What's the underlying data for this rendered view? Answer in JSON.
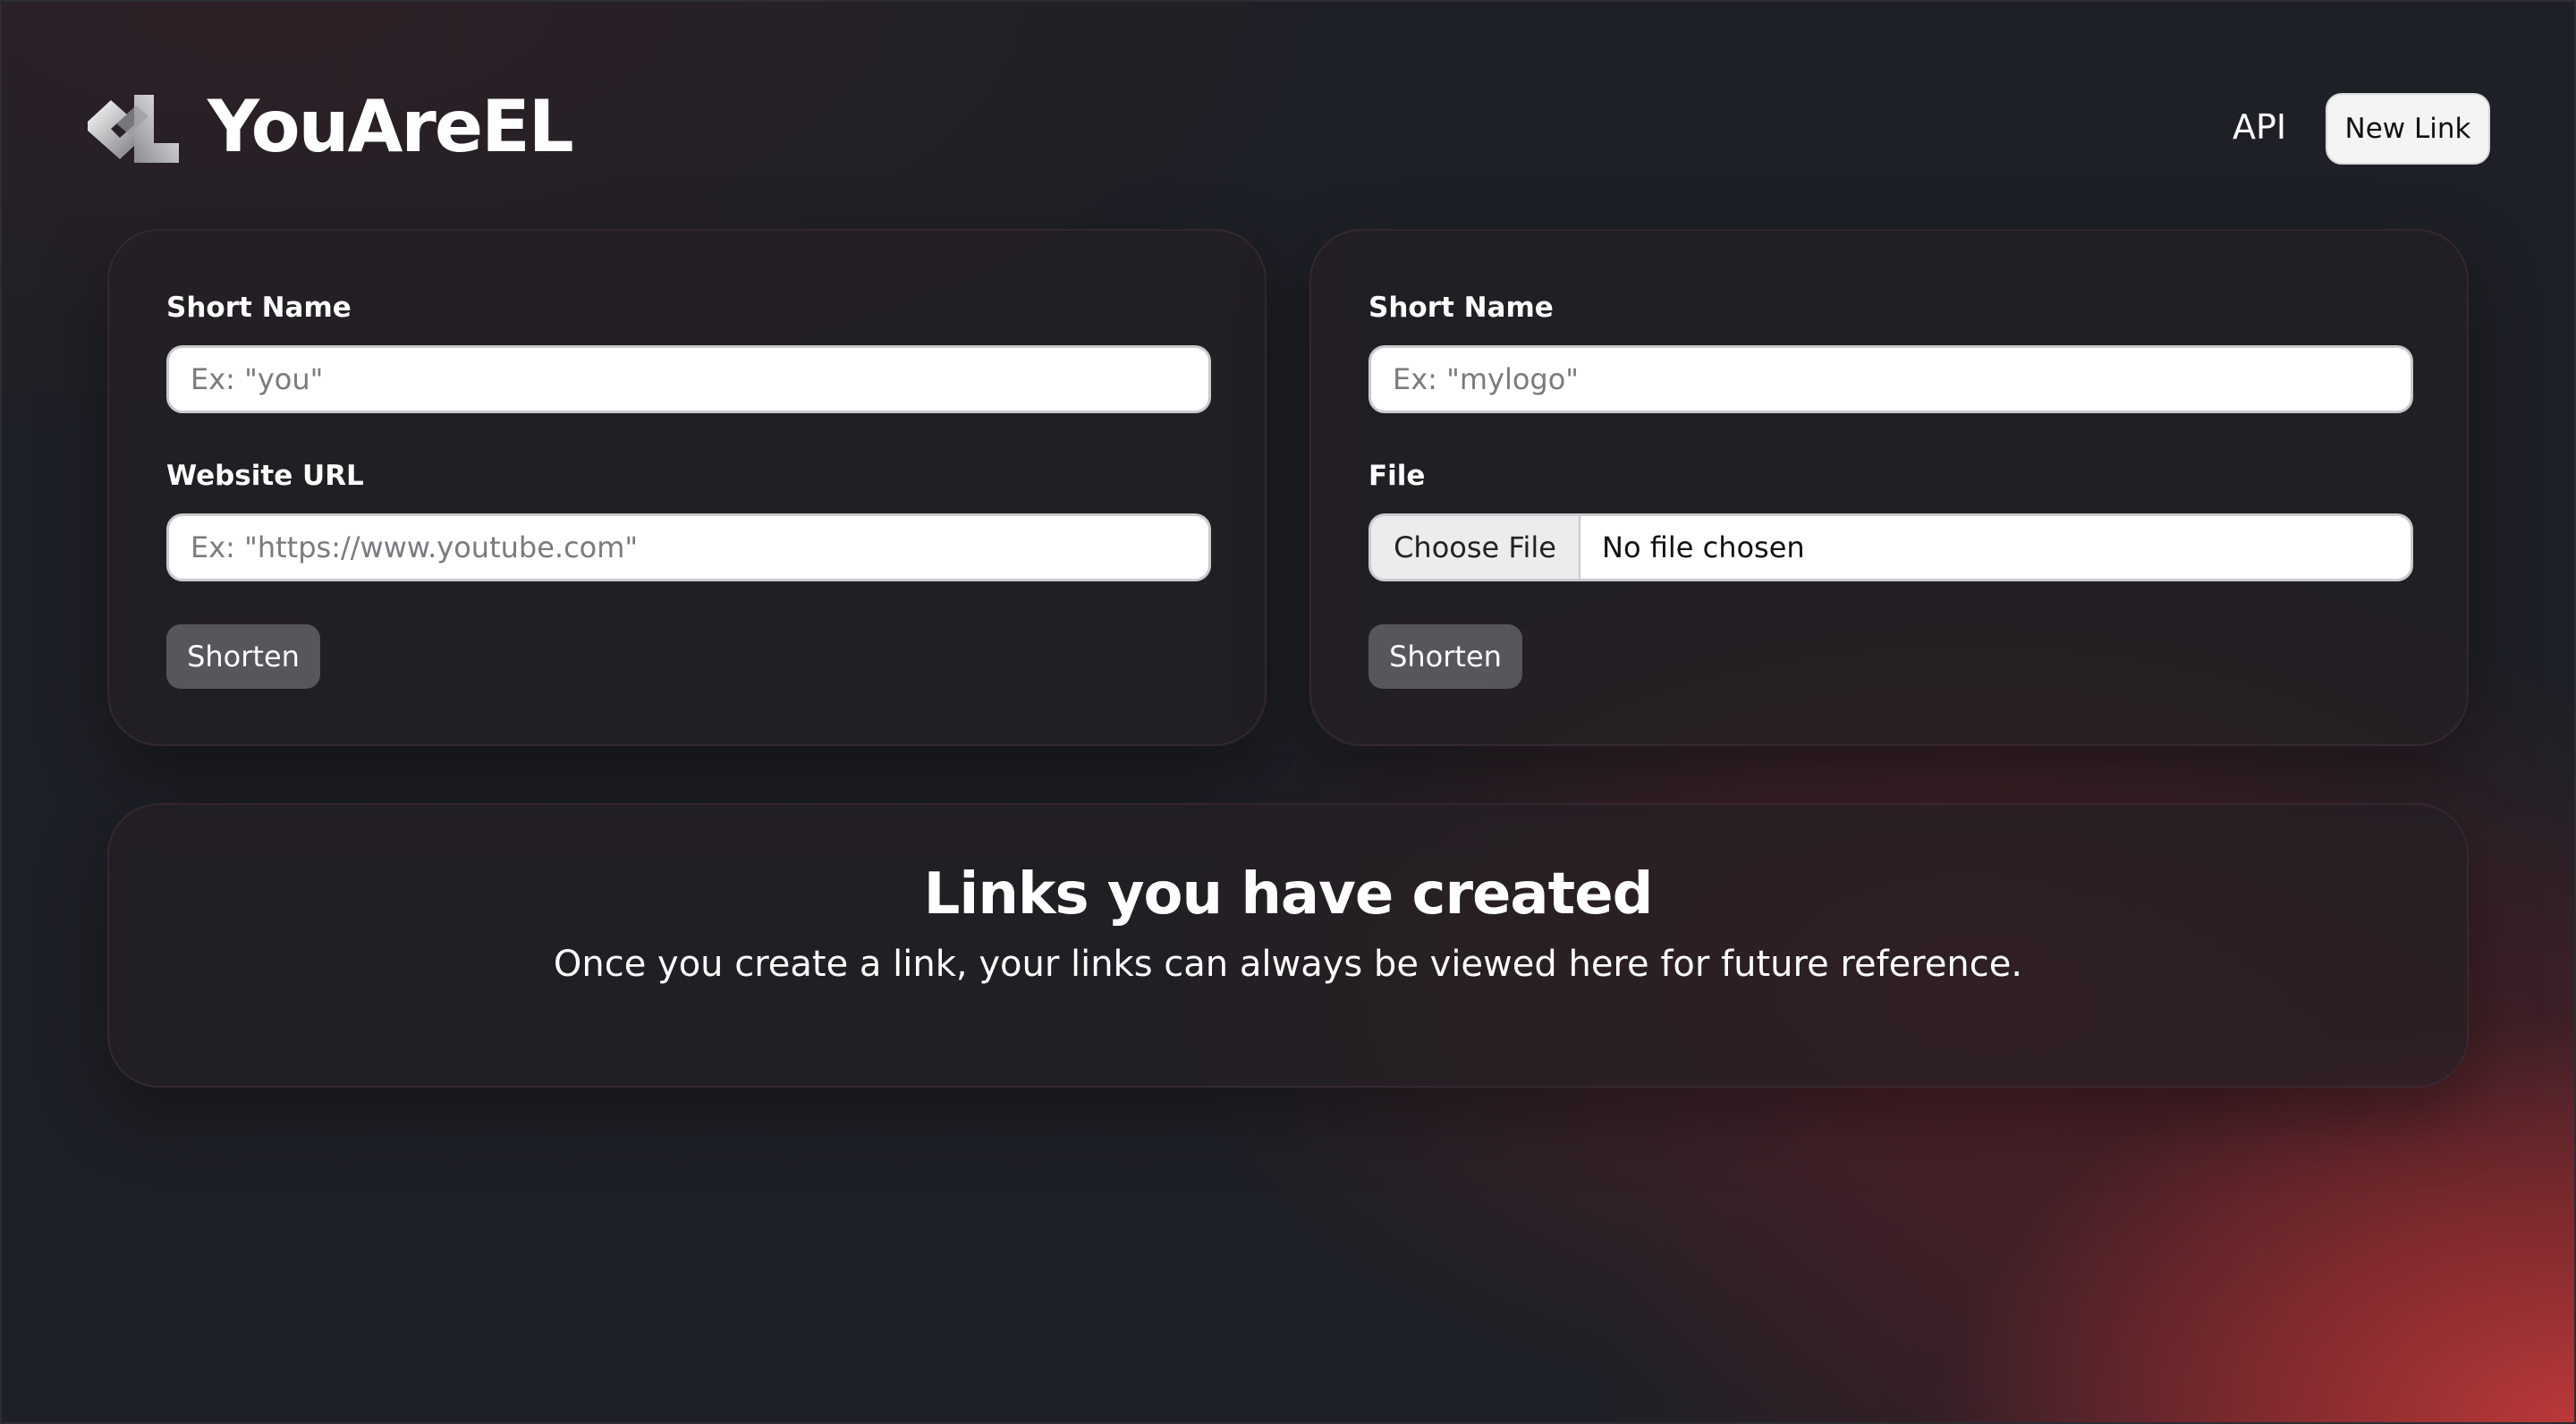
{
  "header": {
    "brand": "YouAreEL",
    "logo_icon": "chain-link-logo-icon",
    "nav": {
      "api_label": "API",
      "new_link_label": "New Link"
    }
  },
  "url_form": {
    "short_name_label": "Short Name",
    "short_name_placeholder": "Ex: \"you\"",
    "website_url_label": "Website URL",
    "website_url_placeholder": "Ex: \"https://www.youtube.com\"",
    "submit_label": "Shorten"
  },
  "file_form": {
    "short_name_label": "Short Name",
    "short_name_placeholder": "Ex: \"mylogo\"",
    "file_label": "File",
    "choose_file_label": "Choose File",
    "file_status": "No file chosen",
    "submit_label": "Shorten"
  },
  "links": {
    "title": "Links you have created",
    "subtitle": "Once you create a link, your links can always be viewed here for future reference."
  },
  "colors": {
    "background": "#1e2027",
    "accent_red": "#c43a3a",
    "button_gray": "#56565c"
  }
}
